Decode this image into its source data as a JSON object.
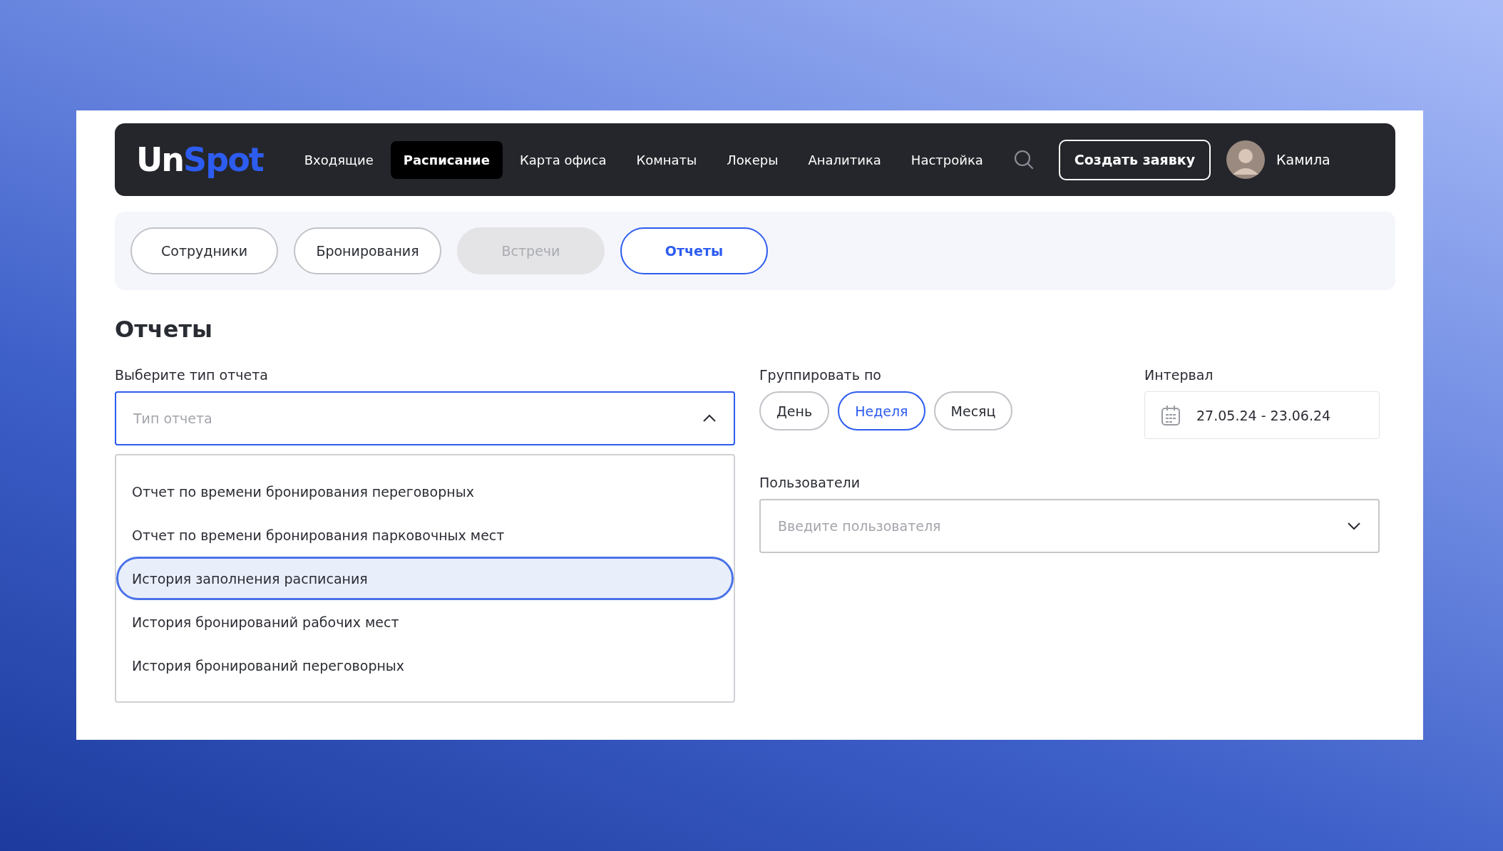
{
  "logo": {
    "part_1": "Un",
    "part_2": "Spot"
  },
  "nav": {
    "items": [
      {
        "label": "Входящие",
        "selected": false
      },
      {
        "label": "Расписание",
        "selected": true
      },
      {
        "label": "Карта офиса",
        "selected": false
      },
      {
        "label": "Комнаты",
        "selected": false
      },
      {
        "label": "Локеры",
        "selected": false
      },
      {
        "label": "Аналитика",
        "selected": false
      },
      {
        "label": "Настройка",
        "selected": false
      }
    ],
    "create_button": "Создать заявку",
    "user_name": "Камила"
  },
  "subtabs": [
    {
      "label": "Сотрудники",
      "selected": false,
      "disabled": false
    },
    {
      "label": "Бронирования",
      "selected": false,
      "disabled": false
    },
    {
      "label": "Встречи",
      "selected": false,
      "disabled": true
    },
    {
      "label": "Отчеты",
      "selected": true,
      "disabled": false
    }
  ],
  "page_title": "Отчеты",
  "report_type": {
    "label": "Выберите тип отчета",
    "placeholder": "Тип отчета",
    "expanded": true,
    "options": [
      {
        "label": "Отчет по времени бронирования переговорных",
        "selected": false
      },
      {
        "label": "Отчет по времени бронирования парковочных мест",
        "selected": false
      },
      {
        "label": "История заполнения расписания",
        "selected": true
      },
      {
        "label": "История бронирований рабочих мест",
        "selected": false
      },
      {
        "label": "История бронирований переговорных",
        "selected": false
      }
    ]
  },
  "group_by": {
    "label": "Группировать по",
    "options": [
      {
        "label": "День",
        "selected": false
      },
      {
        "label": "Неделя",
        "selected": true
      },
      {
        "label": "Месяц",
        "selected": false
      }
    ]
  },
  "interval": {
    "label": "Интервал",
    "value": "27.05.24 - 23.06.24"
  },
  "users": {
    "label": "Пользователи",
    "placeholder": "Введите пользователя",
    "expanded": false
  }
}
